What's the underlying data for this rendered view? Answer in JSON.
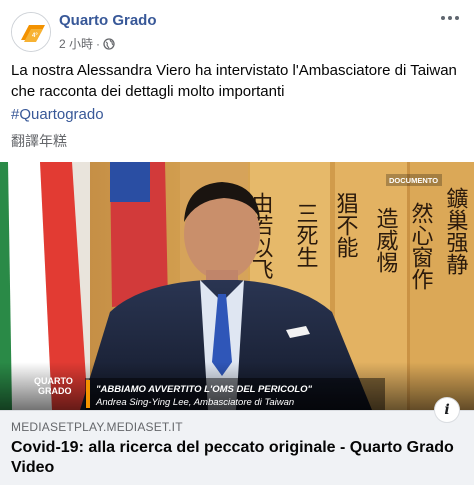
{
  "post": {
    "page_name": "Quarto Grado",
    "time": "2 小時",
    "privacy_icon": "globe-icon",
    "body_text": "La nostra Alessandra Viero ha intervistato l'Ambasciatore di Taiwan che racconta dei dettagli molto importanti",
    "hashtag": "#Quartogrado",
    "translate_label": "翻譯年糕"
  },
  "media": {
    "badge": "DOCUMENTO",
    "watermark_line1": "QUARTO",
    "watermark_line2": "GRADO",
    "caption_quote": "\"ABBIAMO AVVERTITO L'OMS DEL PERICOLO\"",
    "caption_name": "Andrea Sing-Ying Lee, Ambasciatore di Taiwan",
    "calligraphy_col1": "由若以飞",
    "calligraphy_col2": "三死生",
    "calligraphy_col3": "猖不能",
    "calligraphy_col4": "造威惕",
    "calligraphy_col5": "然心窗作",
    "calligraphy_col6": "鑛巢强静"
  },
  "link": {
    "domain": "MEDIASETPLAY.MEDIASET.IT",
    "title": "Covid-19: alla ricerca del peccato originale - Quarto Grado Video",
    "info_label": "i"
  },
  "colors": {
    "link_blue": "#385898",
    "muted": "#65676b",
    "link_bg": "#f0f2f5",
    "brand_orange": "#f39200"
  }
}
